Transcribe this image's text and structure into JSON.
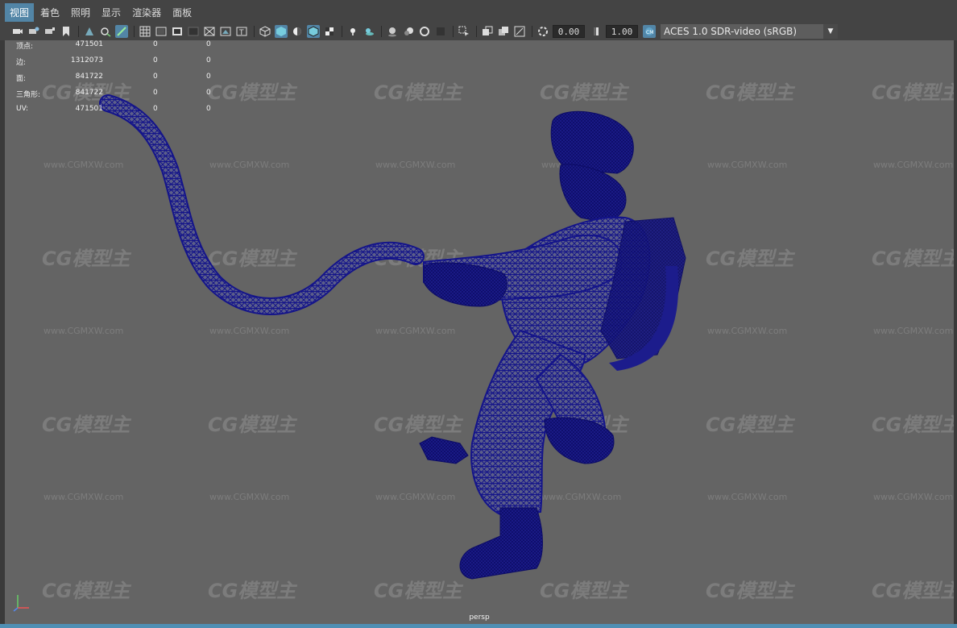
{
  "menu": {
    "items": [
      {
        "label": "视图",
        "active": true
      },
      {
        "label": "着色",
        "active": false
      },
      {
        "label": "照明",
        "active": false
      },
      {
        "label": "显示",
        "active": false
      },
      {
        "label": "渲染器",
        "active": false
      },
      {
        "label": "面板",
        "active": false
      }
    ]
  },
  "toolbar": {
    "exposure_value": "0.00",
    "gamma_value": "1.00",
    "color_space": "ACES 1.0 SDR-video (sRGB)",
    "icons": [
      "camera-icon",
      "camera-attributes-icon",
      "bookmark-icon",
      "image-plane-icon",
      "grid-icon",
      "film-gate-icon",
      "resolution-gate-icon",
      "gate-mask-icon",
      "field-chart-icon",
      "safe-action-icon",
      "safe-title-icon",
      "wireframe-icon",
      "smooth-shade-icon",
      "default-material-icon",
      "shaded-wireframe-icon",
      "textured-icon",
      "use-all-lights-icon",
      "shadows-icon",
      "screen-space-ao-icon",
      "motion-blur-icon",
      "anti-aliasing-icon",
      "depth-of-field-icon",
      "isolate-select-icon",
      "xray-icon",
      "xray-active-components-icon",
      "xray-joints-icon",
      "exposure-icon",
      "gamma-icon",
      "color-management-icon"
    ]
  },
  "hud": {
    "rows": [
      {
        "label": "顶点:",
        "v1": "471501",
        "v2": "0",
        "v3": "0"
      },
      {
        "label": "边:",
        "v1": "1312073",
        "v2": "0",
        "v3": "0"
      },
      {
        "label": "面:",
        "v1": "841722",
        "v2": "0",
        "v3": "0"
      },
      {
        "label": "三角形:",
        "v1": "841722",
        "v2": "0",
        "v3": "0"
      },
      {
        "label": "UV:",
        "v1": "471501",
        "v2": "0",
        "v3": "0"
      }
    ]
  },
  "viewport": {
    "camera_label": "persp",
    "watermark_logo": "CG模型主",
    "watermark_url": "www.CGMXW.com"
  },
  "colors": {
    "accent": "#5285a6",
    "viewport_bg": "#646464",
    "wireframe": "#1a1a8c"
  }
}
